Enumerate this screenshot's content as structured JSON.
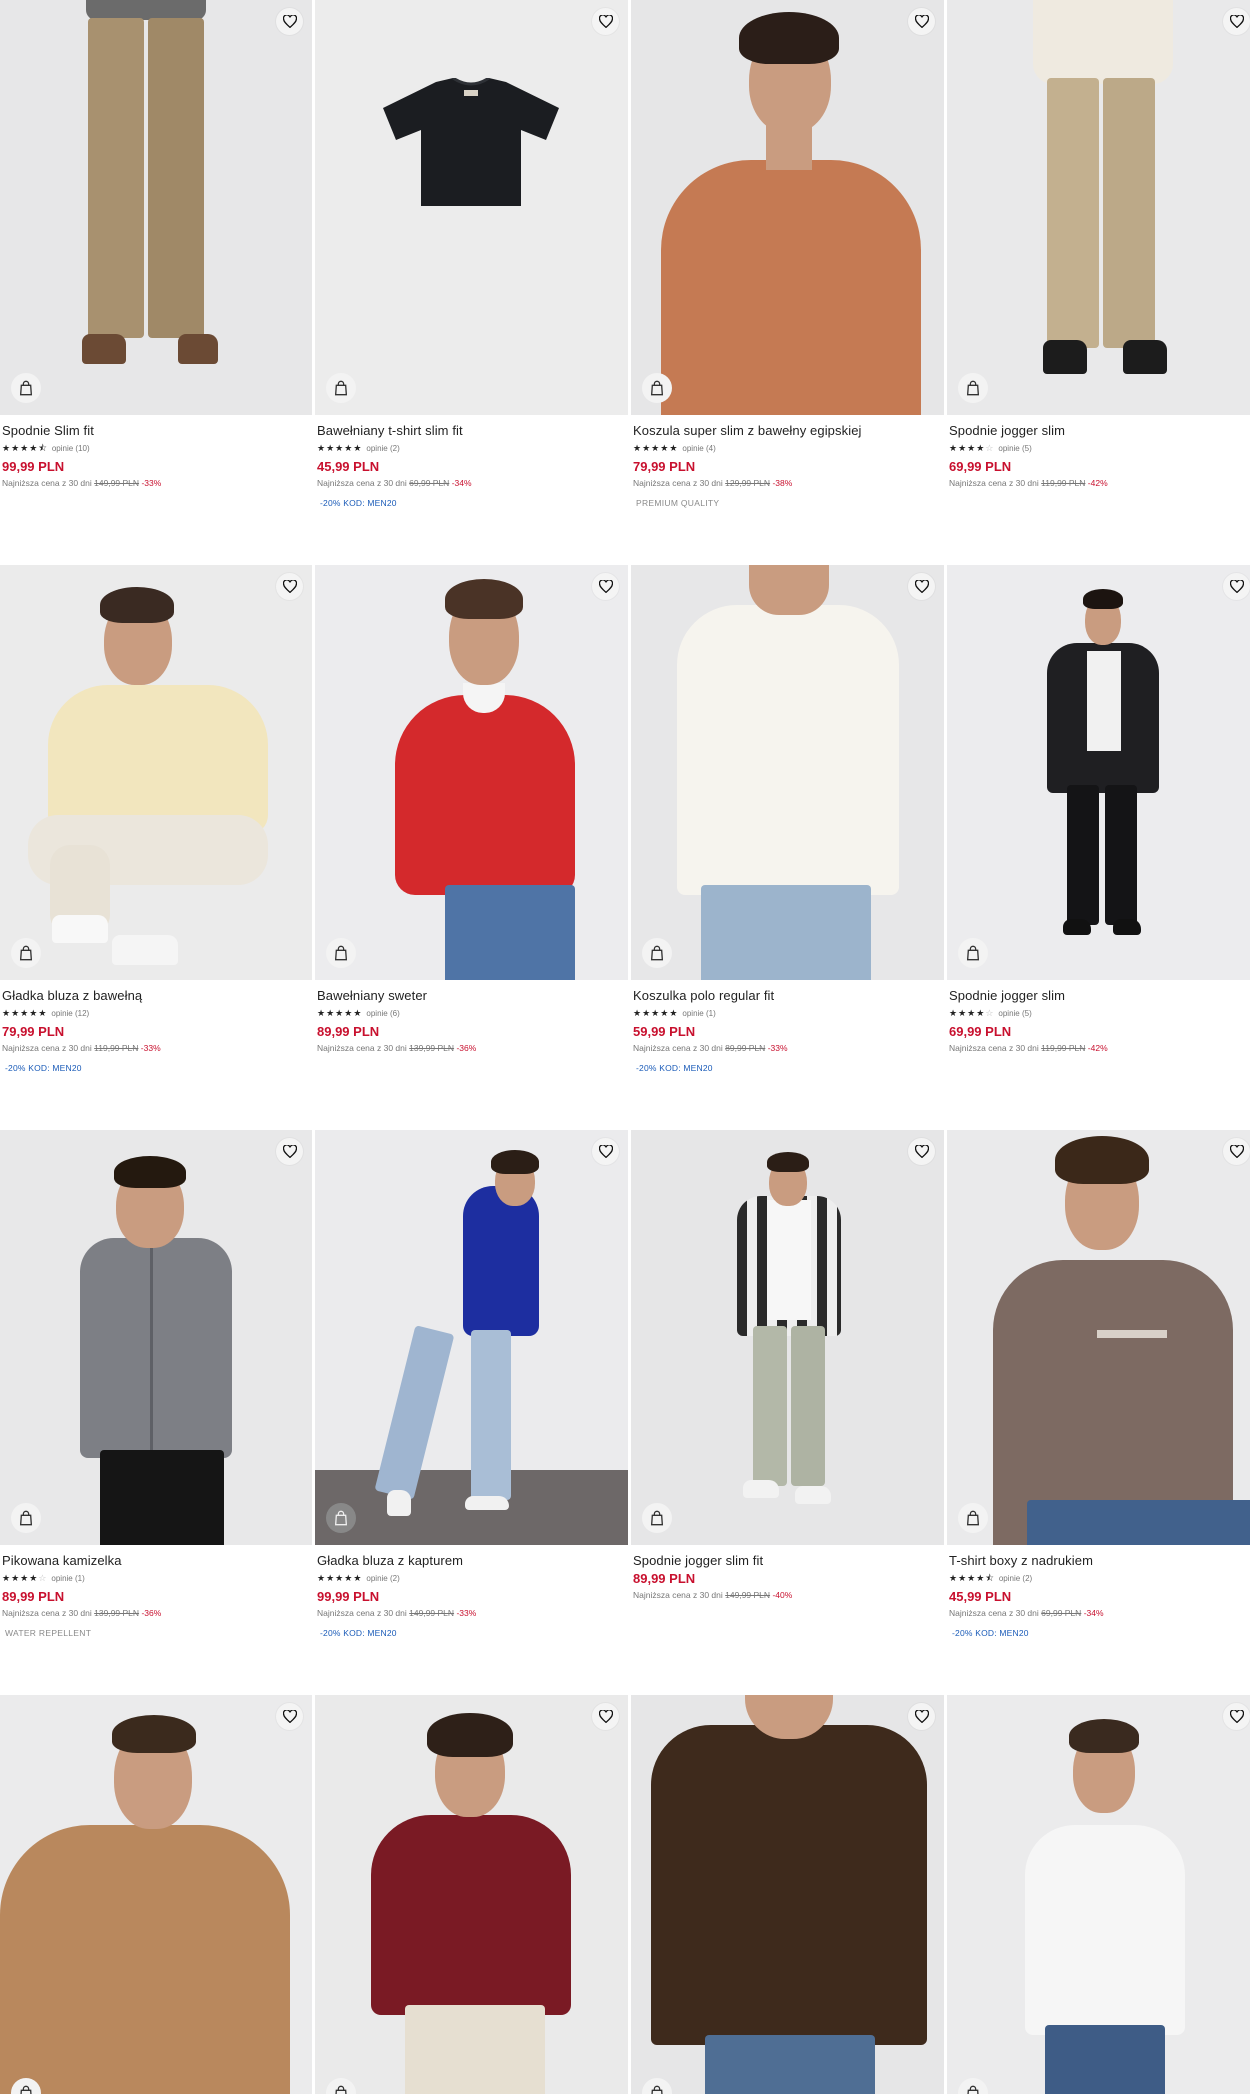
{
  "colors": {
    "price": "#c8102e",
    "promo": "#1a5bb8",
    "tag": "#8a8a8a"
  },
  "icons": {
    "favorite": "heart-outline-icon",
    "add_to_cart": "shopping-bag-icon"
  },
  "labels": {
    "lowest_prefix": "Najniższa cena z 30 dni"
  },
  "products": [
    {
      "name": "Spodnie Slim fit",
      "rating": 4.5,
      "reviews": "opinie (10)",
      "price": "99,99 PLN",
      "old": "149,99 PLN",
      "pct": "-33%",
      "extra": ""
    },
    {
      "name": "Bawełniany t-shirt slim fit",
      "rating": 5,
      "reviews": "opinie (2)",
      "price": "45,99 PLN",
      "old": "69,99 PLN",
      "pct": "-34%",
      "extra": "-20% KOD: MEN20"
    },
    {
      "name": "Koszula super slim z bawełny egipskiej",
      "rating": 5,
      "reviews": "opinie (4)",
      "price": "79,99 PLN",
      "old": "129,99 PLN",
      "pct": "-38%",
      "extra": "PREMIUM QUALITY"
    },
    {
      "name": "Spodnie jogger slim",
      "rating": 4,
      "reviews": "opinie (5)",
      "price": "69,99 PLN",
      "old": "119,99 PLN",
      "pct": "-42%",
      "extra": ""
    },
    {
      "name": "Gładka bluza z bawełną",
      "rating": 5,
      "reviews": "opinie (12)",
      "price": "79,99 PLN",
      "old": "119,99 PLN",
      "pct": "-33%",
      "extra": "-20% KOD: MEN20"
    },
    {
      "name": "Bawełniany sweter",
      "rating": 5,
      "reviews": "opinie (6)",
      "price": "89,99 PLN",
      "old": "139,99 PLN",
      "pct": "-36%",
      "extra": ""
    },
    {
      "name": "Koszulka polo regular fit",
      "rating": 5,
      "reviews": "opinie (1)",
      "price": "59,99 PLN",
      "old": "89,99 PLN",
      "pct": "-33%",
      "extra": "-20% KOD: MEN20"
    },
    {
      "name": "Spodnie jogger slim",
      "rating": 4,
      "reviews": "opinie (5)",
      "price": "69,99 PLN",
      "old": "119,99 PLN",
      "pct": "-42%",
      "extra": ""
    },
    {
      "name": "Pikowana kamizelka",
      "rating": 4,
      "reviews": "opinie (1)",
      "price": "89,99 PLN",
      "old": "139,99 PLN",
      "pct": "-36%",
      "extra": "WATER REPELLENT"
    },
    {
      "name": "Gładka bluza z kapturem",
      "rating": 5,
      "reviews": "opinie (2)",
      "price": "99,99 PLN",
      "old": "149,99 PLN",
      "pct": "-33%",
      "extra": "-20% KOD: MEN20"
    },
    {
      "name": "Spodnie jogger slim fit",
      "rating": 0,
      "reviews": "",
      "price": "89,99 PLN",
      "old": "149,99 PLN",
      "pct": "-40%",
      "extra": ""
    },
    {
      "name": "T-shirt boxy z nadrukiem",
      "rating": 4.5,
      "reviews": "opinie (2)",
      "price": "45,99 PLN",
      "old": "69,99 PLN",
      "pct": "-34%",
      "extra": "-20% KOD: MEN20"
    },
    {
      "name": "",
      "rating": 0,
      "reviews": "",
      "price": "",
      "old": "",
      "pct": "",
      "extra": ""
    },
    {
      "name": "",
      "rating": 0,
      "reviews": "",
      "price": "",
      "old": "",
      "pct": "",
      "extra": ""
    },
    {
      "name": "",
      "rating": 0,
      "reviews": "",
      "price": "",
      "old": "",
      "pct": "",
      "extra": ""
    },
    {
      "name": "",
      "rating": 0,
      "reviews": "",
      "price": "",
      "old": "",
      "pct": "",
      "extra": ""
    }
  ]
}
